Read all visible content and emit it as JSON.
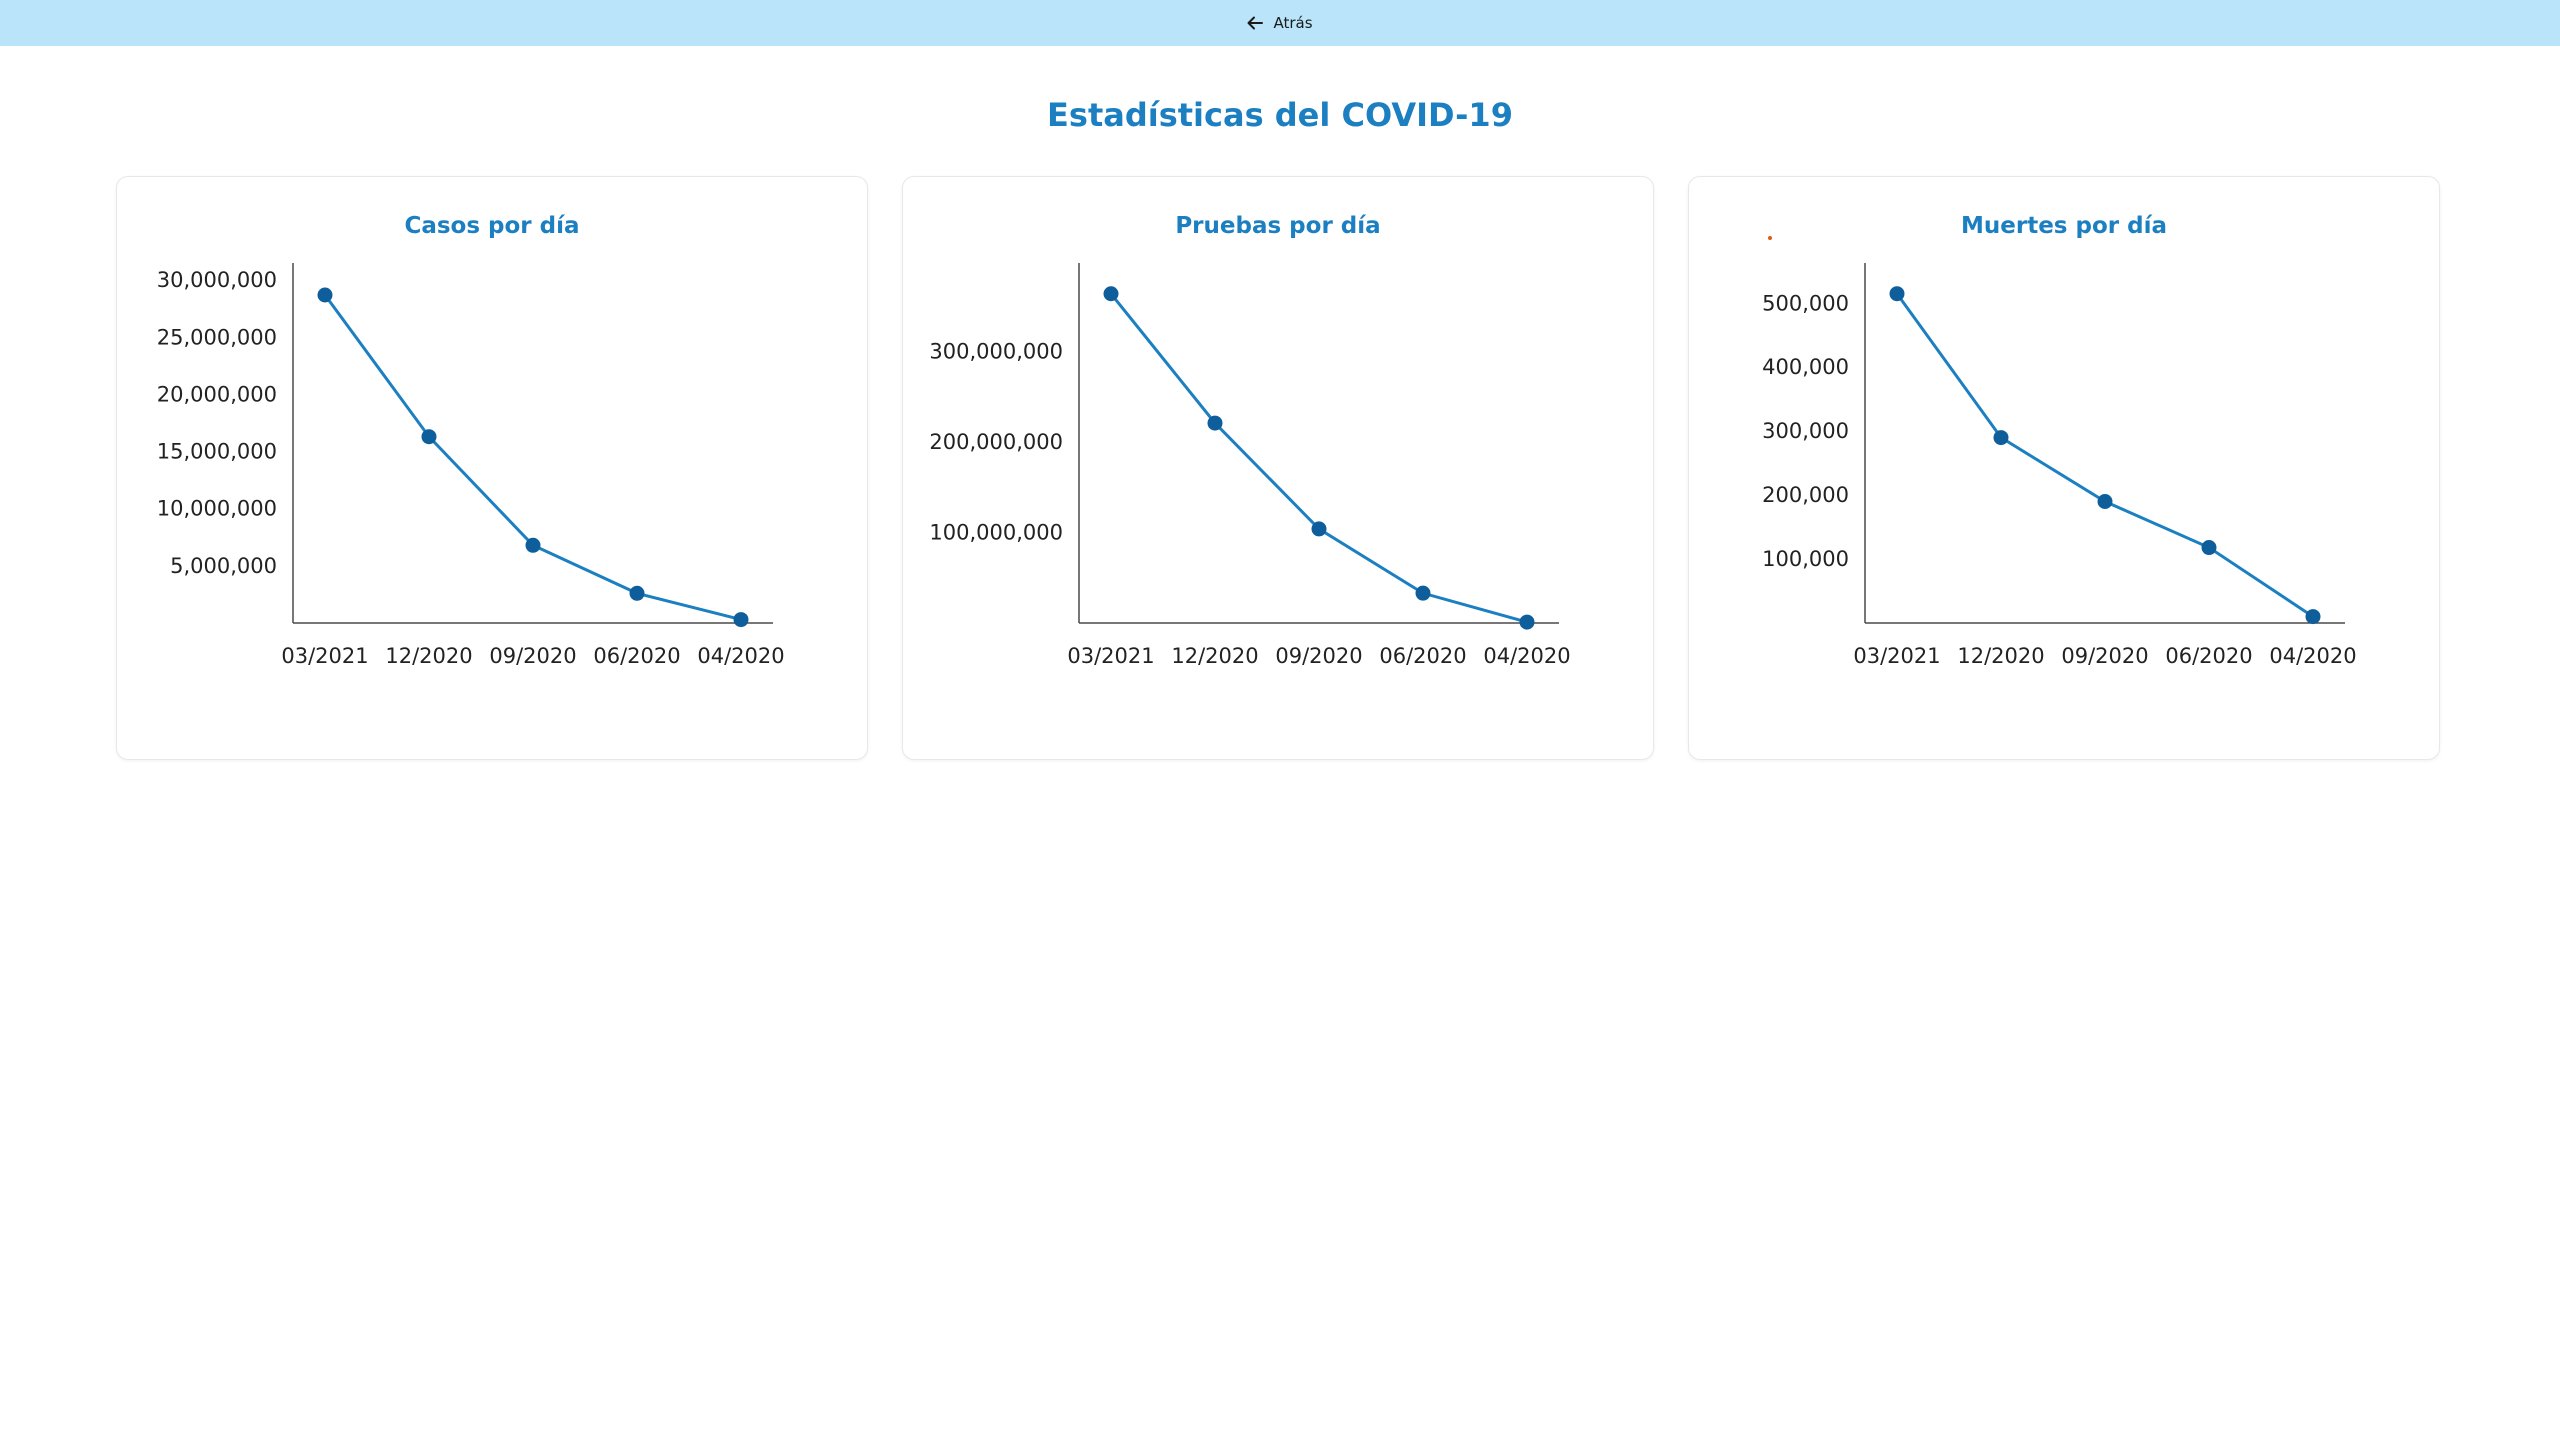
{
  "nav": {
    "back_label": "Atrás"
  },
  "page": {
    "title": "Estadísticas del COVID-19"
  },
  "colors": {
    "accent": "#1b7fc1",
    "point": "#0f5e9c",
    "topbar": "#b9e4fa"
  },
  "chart_data": [
    {
      "type": "line",
      "title": "Casos por día",
      "x": [
        "03/2021",
        "12/2020",
        "09/2020",
        "06/2020",
        "04/2020"
      ],
      "y": [
        28700000,
        16300000,
        6800000,
        2600000,
        300000
      ],
      "yticks": [
        5000000,
        10000000,
        15000000,
        20000000,
        25000000,
        30000000
      ],
      "ytick_labels": [
        "5,000,000",
        "10,000,000",
        "15,000,000",
        "20,000,000",
        "25,000,000",
        "30,000,000"
      ],
      "ylim": [
        0,
        31500000
      ],
      "grid": false,
      "legend": "none"
    },
    {
      "type": "line",
      "title": "Pruebas por día",
      "x": [
        "03/2021",
        "12/2020",
        "09/2020",
        "06/2020",
        "04/2020"
      ],
      "y": [
        364000000,
        221000000,
        104000000,
        33000000,
        1000000
      ],
      "yticks": [
        100000000,
        200000000,
        300000000
      ],
      "ytick_labels": [
        "100,000,000",
        "200,000,000",
        "300,000,000"
      ],
      "ylim": [
        0,
        398000000
      ],
      "grid": false,
      "legend": "none"
    },
    {
      "type": "line",
      "title": "Muertes por día",
      "x": [
        "03/2021",
        "12/2020",
        "09/2020",
        "06/2020",
        "04/2020"
      ],
      "y": [
        515000,
        290000,
        190000,
        118000,
        10000
      ],
      "yticks": [
        100000,
        200000,
        300000,
        400000,
        500000
      ],
      "ytick_labels": [
        "100,000",
        "200,000",
        "300,000",
        "400,000",
        "500,000"
      ],
      "ylim": [
        0,
        563000
      ],
      "grid": false,
      "legend": "none"
    }
  ]
}
